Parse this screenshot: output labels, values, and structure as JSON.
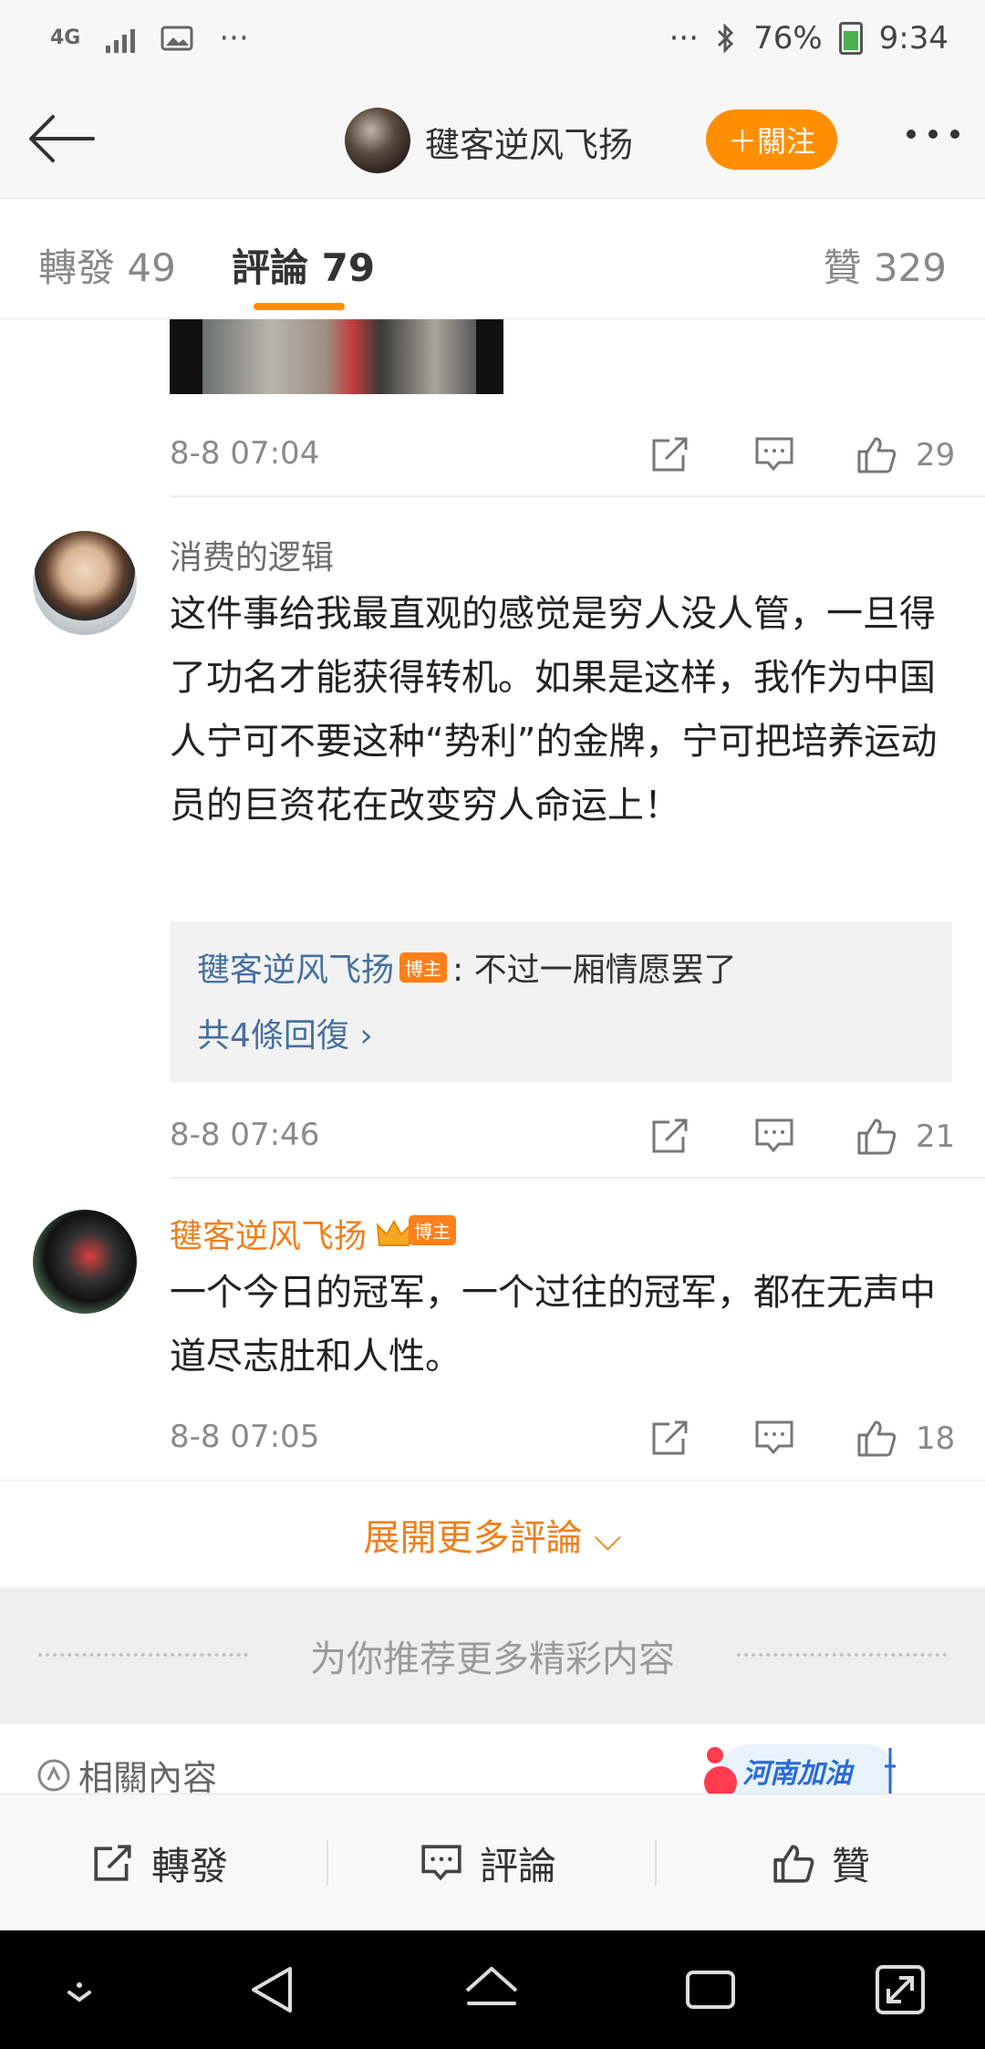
{
  "status_bar": {
    "network": "4G",
    "dots_left": "···",
    "dots_right": "···",
    "battery": "76%",
    "time": "9:34"
  },
  "header": {
    "author_name": "毽客逆风飞扬",
    "follow_label": "＋關注"
  },
  "tabs": {
    "repost": "轉發 49",
    "comments": "評論 79",
    "likes": "贊 329"
  },
  "top_meta": {
    "time": "8-8 07:04",
    "likes": "29"
  },
  "comments": [
    {
      "username": "消费的逻辑",
      "text": "这件事给我最直观的感觉是穷人没人管，一旦得了功名才能获得转机。如果是这样，我作为中国人宁可不要这种“势利”的金牌，宁可把培养运动员的巨资花在改变穷人命运上！",
      "reply_name": "毽客逆风飞扬",
      "reply_badge": "博主",
      "reply_text": ": 不过一厢情愿罢了",
      "reply_more": "共4條回復 ›",
      "time": "8-8 07:46",
      "likes": "21"
    },
    {
      "username": "毽客逆风飞扬",
      "badge": "博主",
      "text": "一个今日的冠军，一个过往的冠军，都在无声中道尽志肚和人性。",
      "time": "8-8 07:05",
      "likes": "18"
    }
  ],
  "expand_label": "展開更多評論 ⌵",
  "recommend_label": "为你推荐更多精彩内容",
  "related_label": "相關內容",
  "promo_text": "河南加油",
  "toolbar": {
    "repost": "轉發",
    "comment": "評論",
    "like": "贊"
  }
}
